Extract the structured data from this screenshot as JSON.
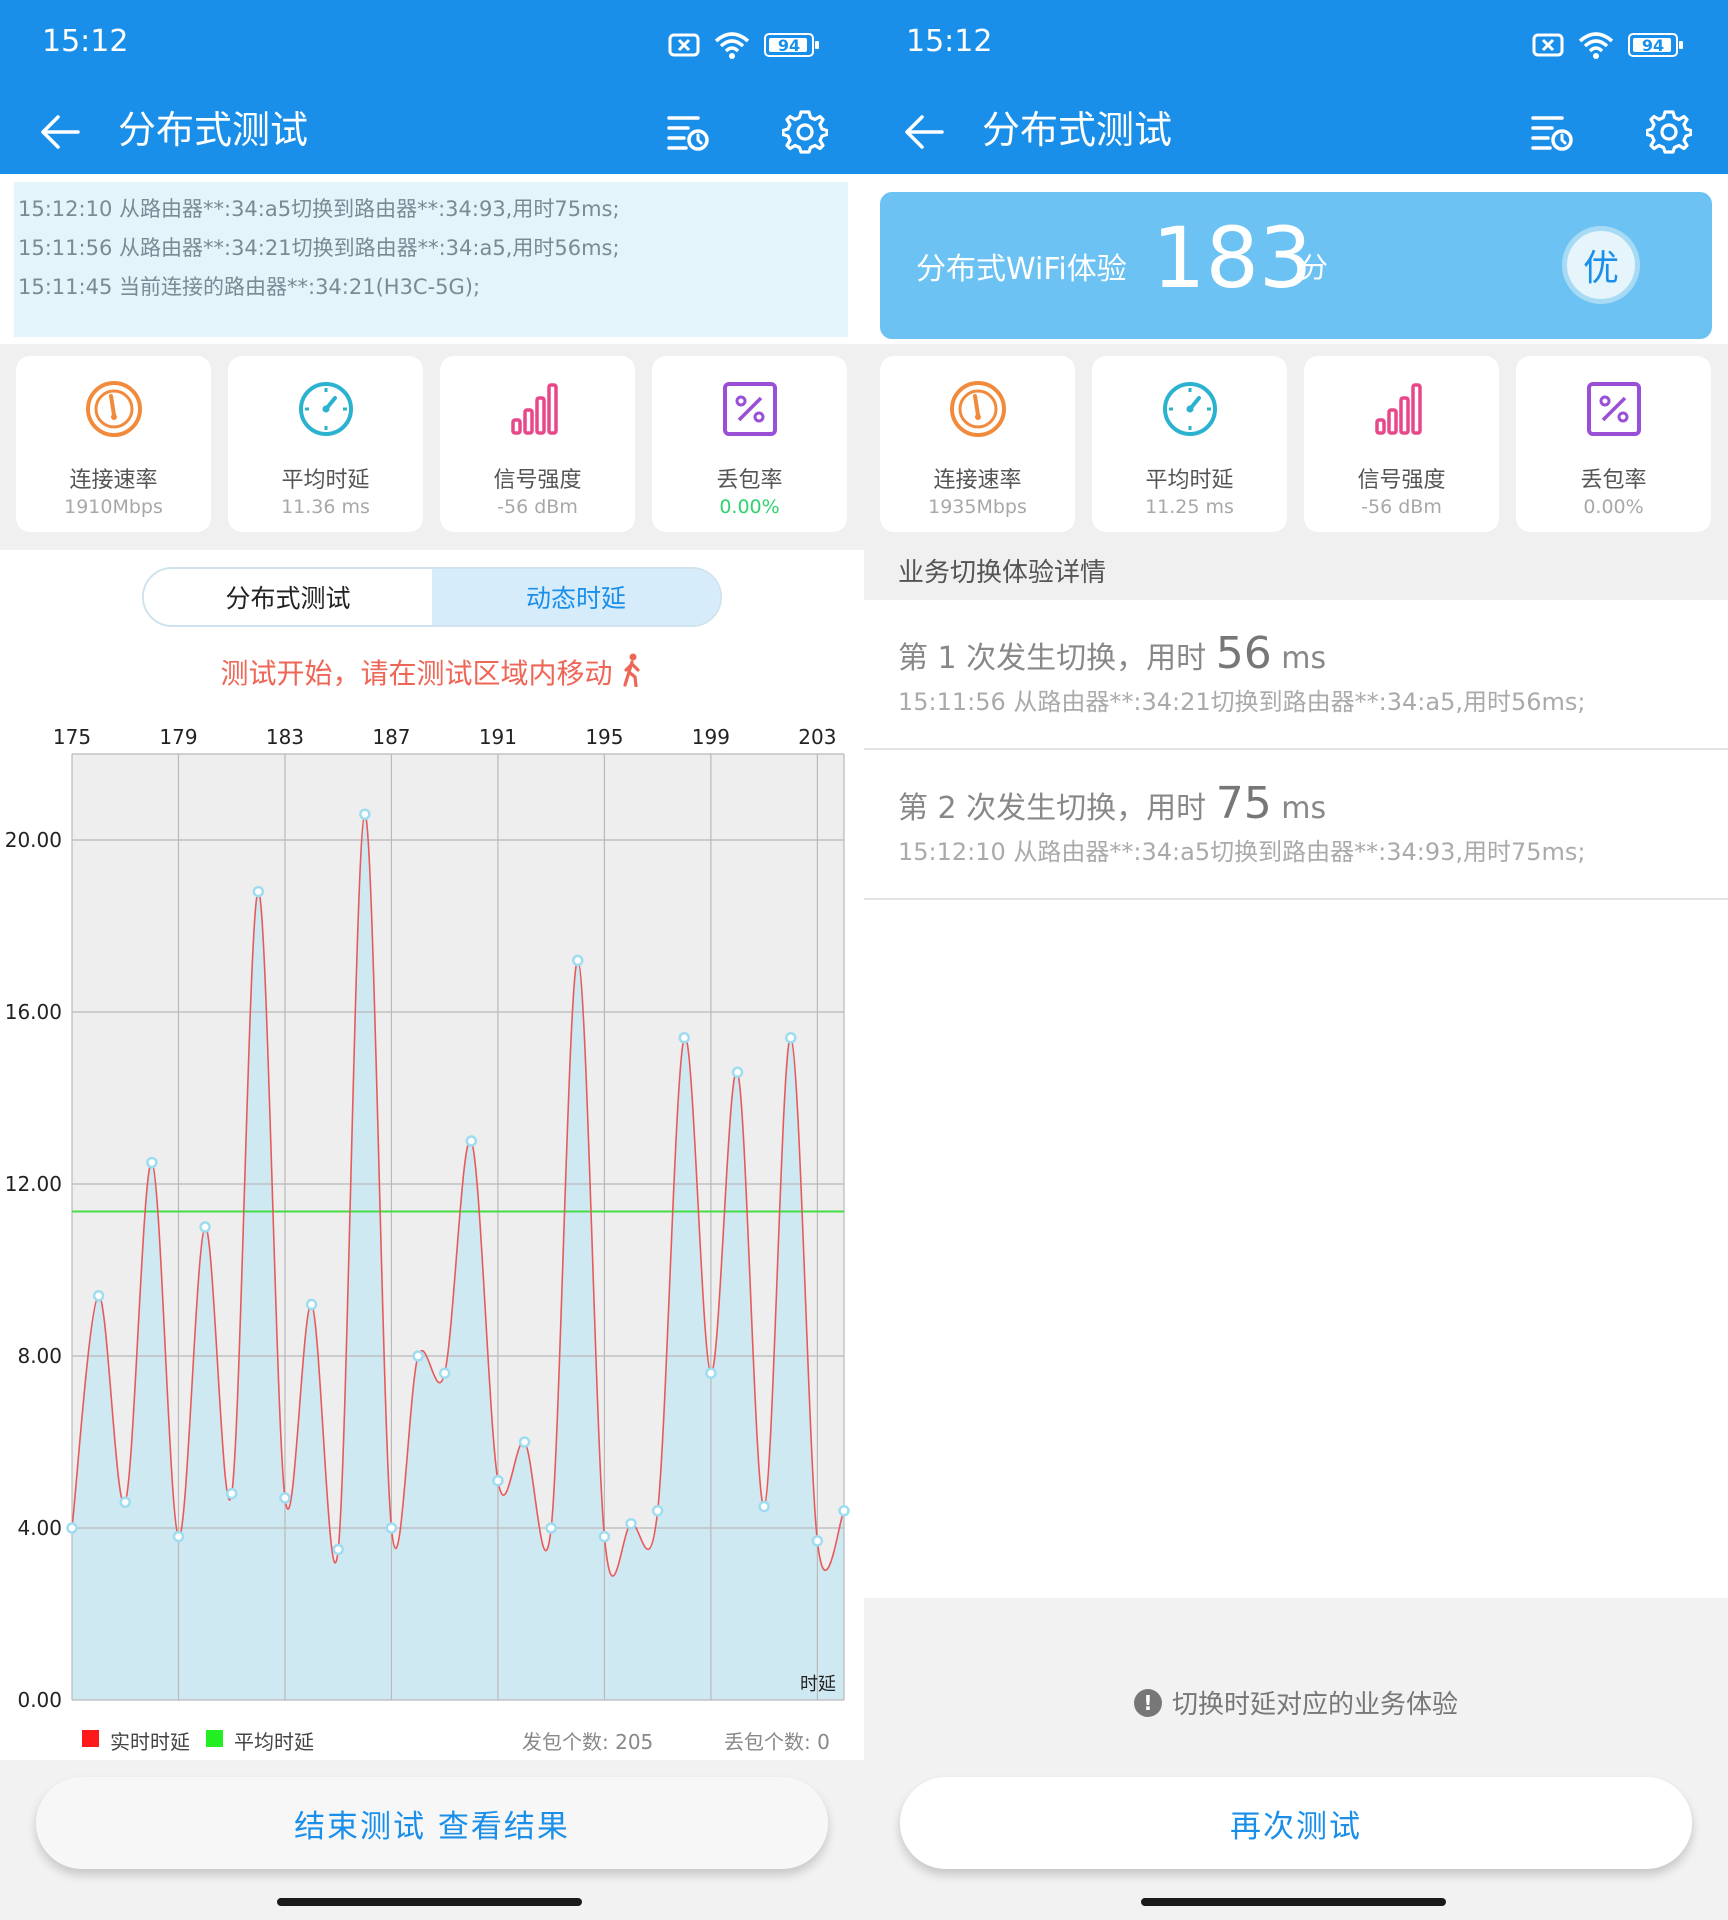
{
  "status": {
    "time": "15:12",
    "battery": "94"
  },
  "appbar": {
    "title": "分布式测试"
  },
  "log": [
    "15:12:10 从路由器**:34:a5切换到路由器**:34:93,用时75ms;",
    "15:11:56 从路由器**:34:21切换到路由器**:34:a5,用时56ms;",
    "15:11:45 当前连接的路由器**:34:21(H3C-5G);"
  ],
  "left_stats": [
    {
      "label": "连接速率",
      "value": "1910Mbps",
      "icon": "speedometer-icon"
    },
    {
      "label": "平均时延",
      "value": "11.36 ms",
      "icon": "timer-icon"
    },
    {
      "label": "信号强度",
      "value": "-56 dBm",
      "icon": "signal-bars-icon"
    },
    {
      "label": "丢包率",
      "value": "0.00%",
      "icon": "percent-icon"
    }
  ],
  "right_stats": [
    {
      "label": "连接速率",
      "value": "1935Mbps"
    },
    {
      "label": "平均时延",
      "value": "11.25 ms"
    },
    {
      "label": "信号强度",
      "value": "-56 dBm"
    },
    {
      "label": "丢包率",
      "value": "0.00%"
    }
  ],
  "tabs": {
    "tab1": "分布式测试",
    "tab2": "动态时延"
  },
  "hint": "测试开始，请在测试区域内移动",
  "chart_data": {
    "type": "line",
    "xlabel": "时延",
    "x_ticks": [
      175,
      179,
      183,
      187,
      191,
      195,
      199,
      203
    ],
    "y_ticks": [
      "0.00",
      "4.00",
      "8.00",
      "12.00",
      "16.00",
      "20.00"
    ],
    "xlim": [
      175,
      204
    ],
    "ylim": [
      0,
      22
    ],
    "series": [
      {
        "name": "实时时延",
        "x": [
          175,
          176,
          177,
          178,
          179,
          180,
          181,
          182,
          183,
          184,
          185,
          186,
          187,
          188,
          189,
          190,
          191,
          192,
          193,
          194,
          195,
          196,
          197,
          198,
          199,
          200,
          201,
          202,
          203,
          204
        ],
        "values": [
          4.0,
          9.4,
          4.6,
          12.5,
          3.8,
          11.0,
          4.8,
          18.8,
          4.7,
          9.2,
          3.5,
          20.6,
          4.0,
          8.0,
          7.6,
          13.0,
          5.1,
          6.0,
          4.0,
          17.2,
          3.8,
          4.1,
          4.4,
          15.4,
          7.6,
          14.6,
          4.5,
          15.4,
          3.7,
          4.4
        ],
        "color": "#e85a5a"
      },
      {
        "name": "平均时延",
        "value": 11.36,
        "color": "#44dd44"
      }
    ],
    "legend": [
      {
        "label": "实时时延",
        "color": "#ff1a1a"
      },
      {
        "label": "平均时延",
        "color": "#22ee22"
      }
    ],
    "sent": "发包个数: 205",
    "lost": "丢包个数: 0"
  },
  "left_button": "结束测试  查看结果",
  "score": {
    "label": "分布式WiFi体验",
    "value": "183",
    "unit": "分",
    "grade": "优"
  },
  "section_title": "业务切换体验详情",
  "switches": [
    {
      "prefix": "第 1 次发生切换，用时",
      "ms": "56",
      "unit": "ms",
      "detail": "15:11:56 从路由器**:34:21切换到路由器**:34:a5,用时56ms;"
    },
    {
      "prefix": "第 2 次发生切换，用时",
      "ms": "75",
      "unit": "ms",
      "detail": "15:12:10 从路由器**:34:a5切换到路由器**:34:93,用时75ms;"
    }
  ],
  "note": "切换时延对应的业务体验",
  "right_button": "再次测试",
  "colors": {
    "primary": "#1a8fea",
    "score_bg": "#6cc2f2",
    "chart_fill": "#cfe9f3",
    "chart_bg": "#eeeeee"
  }
}
